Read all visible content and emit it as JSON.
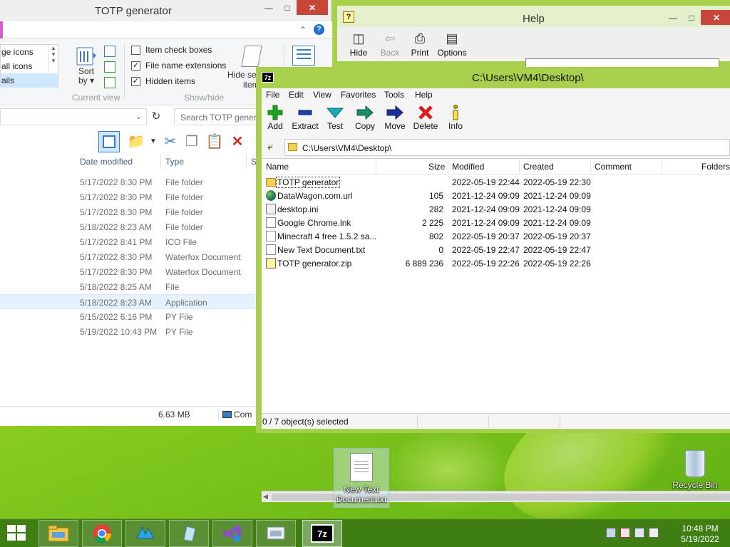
{
  "explorer": {
    "title": "TOTP generator",
    "layout_items": [
      "ge icons",
      "all icons",
      "ails"
    ],
    "sort_label": "Sort",
    "sort_label2": "by",
    "current_view_label": "Current view",
    "checkboxes": [
      {
        "label": "Item check boxes",
        "checked": false
      },
      {
        "label": "File name extensions",
        "checked": true
      },
      {
        "label": "Hidden items",
        "checked": true
      }
    ],
    "hide_selected_label": "Hide se",
    "hide_selected_label2": "item",
    "show_hide_label": "Show/hide",
    "search_placeholder": "Search TOTP genera",
    "columns": {
      "date": "Date modified",
      "type": "Type",
      "size_stub": "S"
    },
    "rows": [
      {
        "date": "5/17/2022 8:30 PM",
        "type": "File folder"
      },
      {
        "date": "5/17/2022 8:30 PM",
        "type": "File folder"
      },
      {
        "date": "5/17/2022 8:30 PM",
        "type": "File folder"
      },
      {
        "date": "5/18/2022 8:23 AM",
        "type": "File folder"
      },
      {
        "date": "5/17/2022 8:41 PM",
        "type": "ICO File"
      },
      {
        "date": "5/17/2022 8:30 PM",
        "type": "Waterfox Document"
      },
      {
        "date": "5/17/2022 8:30 PM",
        "type": "Waterfox Document"
      },
      {
        "date": "5/18/2022 8:25 AM",
        "type": "File"
      },
      {
        "date": "5/18/2022 8:23 AM",
        "type": "Application"
      },
      {
        "date": "5/15/2022 6:16 PM",
        "type": "PY File"
      },
      {
        "date": "5/19/2022 10:43 PM",
        "type": "PY File"
      }
    ],
    "selected_row": 8,
    "status_size": "6.63 MB",
    "status_computer": "Com"
  },
  "help": {
    "title": "Help",
    "tools": [
      {
        "label": "Hide",
        "icon": "hide-icon",
        "enabled": true
      },
      {
        "label": "Back",
        "icon": "back-arrow-icon",
        "enabled": false
      },
      {
        "label": "Print",
        "icon": "print-icon",
        "enabled": true
      },
      {
        "label": "Options",
        "icon": "options-icon",
        "enabled": true
      }
    ]
  },
  "zip": {
    "title": "C:\\Users\\VM4\\Desktop\\",
    "icon_text": "7z",
    "menu": [
      "File",
      "Edit",
      "View",
      "Favorites",
      "Tools",
      "Help"
    ],
    "tools": [
      {
        "label": "Add",
        "icon": "add-plus-icon",
        "color": "#1aa51a"
      },
      {
        "label": "Extract",
        "icon": "extract-minus-icon",
        "color": "#1e3fa8"
      },
      {
        "label": "Test",
        "icon": "test-check-icon",
        "color": "#1aa7b8"
      },
      {
        "label": "Copy",
        "icon": "copy-arrow-icon",
        "color": "#1a8a6a"
      },
      {
        "label": "Move",
        "icon": "move-arrow-icon",
        "color": "#1e2f9a"
      },
      {
        "label": "Delete",
        "icon": "delete-x-icon",
        "color": "#d81e1e"
      },
      {
        "label": "Info",
        "icon": "info-icon",
        "color": "#c8a400"
      }
    ],
    "path": "C:\\Users\\VM4\\Desktop\\",
    "columns": [
      "Name",
      "Size",
      "Modified",
      "Created",
      "Comment",
      "Folders"
    ],
    "files": [
      {
        "name": "TOTP generator",
        "size": "",
        "modified": "2022-05-19 22:44",
        "created": "2022-05-19 22:30",
        "icon": "folder-icon"
      },
      {
        "name": "DataWagon.com.url",
        "size": "105",
        "modified": "2021-12-24 09:09",
        "created": "2021-12-24 09:09",
        "icon": "globe-icon"
      },
      {
        "name": "desktop.ini",
        "size": "282",
        "modified": "2021-12-24 09:09",
        "created": "2021-12-24 09:09",
        "icon": "settings-file-icon"
      },
      {
        "name": "Google Chrome.lnk",
        "size": "2 225",
        "modified": "2021-12-24 09:09",
        "created": "2021-12-24 09:09",
        "icon": "file-icon"
      },
      {
        "name": "Minecraft 4 free 1.5.2 sa...",
        "size": "802",
        "modified": "2022-05-19 20:37",
        "created": "2022-05-19 20:37",
        "icon": "file-icon"
      },
      {
        "name": "New Text Document.txt",
        "size": "0",
        "modified": "2022-05-19 22:47",
        "created": "2022-05-19 22:47",
        "icon": "text-file-icon"
      },
      {
        "name": "TOTP generator.zip",
        "size": "6 889 236",
        "modified": "2022-05-19 22:26",
        "created": "2022-05-19 22:26",
        "icon": "zip-file-icon"
      }
    ],
    "status": "0 / 7 object(s) selected"
  },
  "desktop": {
    "new_text_doc": "New Text Document.txt",
    "recycle_bin": "Recycle Bin"
  },
  "taskbar": {
    "time": "10:48 PM",
    "date": "5/19/2022",
    "apps": [
      "file-explorer",
      "chrome",
      "waterfox",
      "python-idle",
      "visual-studio",
      "control-panel",
      "7-zip"
    ],
    "active_app": "7-zip",
    "zip_icon_text": "7z"
  }
}
